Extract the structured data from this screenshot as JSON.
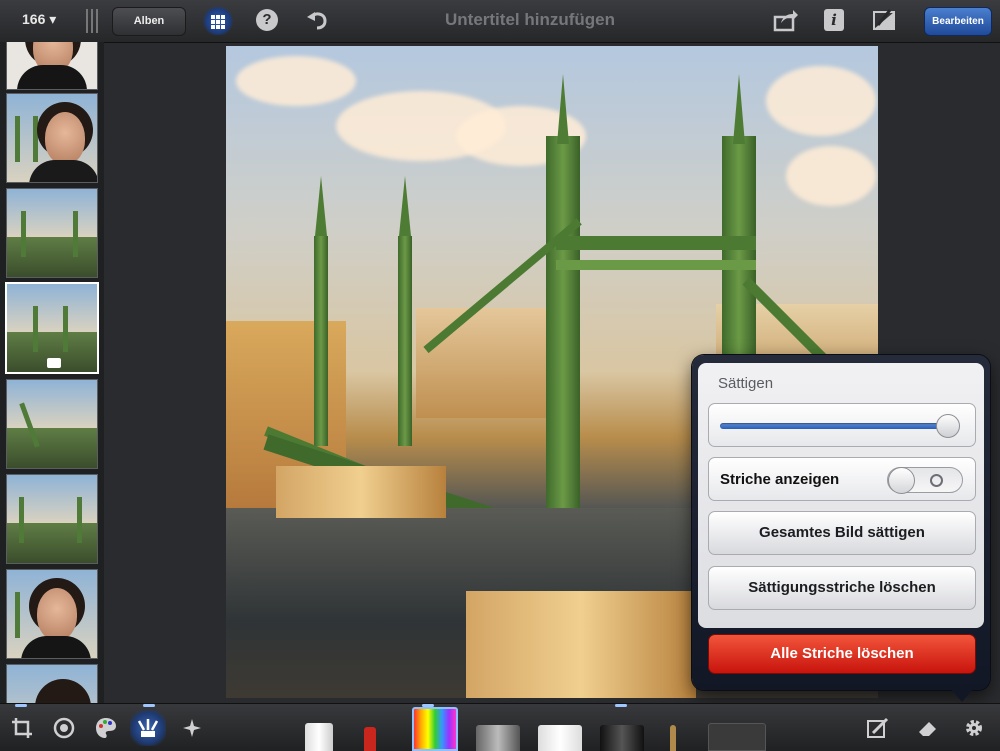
{
  "header": {
    "photo_count": "166 ▾",
    "back_label": "Alben",
    "title": "Untertitel hinzufügen",
    "help_label": "?",
    "info_label": "i",
    "edit_label": "Bearbeiten"
  },
  "popover": {
    "title": "Sättigen",
    "slider_fraction": 0.97,
    "toggle_label": "Striche anzeigen",
    "toggle_on": false,
    "button_saturate_all": "Gesamtes Bild sättigen",
    "button_clear_saturation": "Sättigungsstriche löschen",
    "button_clear_all": "Alle Striche löschen"
  },
  "colors": {
    "accent_blue": "#2a5db7",
    "danger_red": "#d71f12",
    "toolbar_dark": "#262729"
  },
  "toolbar": {
    "tools": [
      "crop-icon",
      "exposure-icon",
      "palette-icon",
      "brushes-icon",
      "effects-icon"
    ],
    "active_tool": "brushes-icon",
    "right_tools": [
      "brush-stroke-icon",
      "eraser-icon",
      "settings-gear-icon"
    ]
  }
}
